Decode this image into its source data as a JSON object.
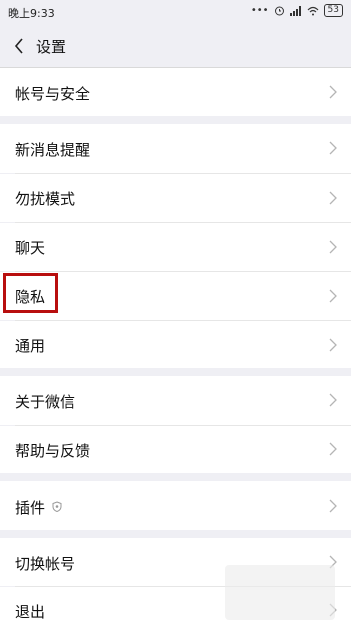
{
  "status_bar": {
    "time": "晚上9:33",
    "battery": "53"
  },
  "navbar": {
    "title": "设置"
  },
  "items": [
    {
      "label": "帐号与安全"
    },
    {
      "label": "新消息提醒"
    },
    {
      "label": "勿扰模式"
    },
    {
      "label": "聊天"
    },
    {
      "label": "隐私"
    },
    {
      "label": "通用"
    },
    {
      "label": "关于微信"
    },
    {
      "label": "帮助与反馈"
    },
    {
      "label": "插件"
    },
    {
      "label": "切换帐号"
    },
    {
      "label": "退出"
    }
  ],
  "colors": {
    "highlight": "#b80e0e",
    "background": "#efeff4"
  }
}
